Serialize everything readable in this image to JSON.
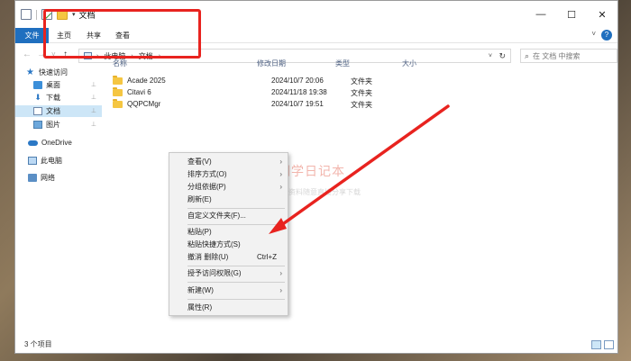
{
  "window": {
    "title": "文档",
    "quick_access_dropdown": "▾",
    "controls": {
      "minimize": "—",
      "maximize": "☐",
      "close": "✕"
    }
  },
  "ribbon": {
    "tabs": [
      {
        "label": "文件"
      },
      {
        "label": "主页"
      },
      {
        "label": "共享"
      },
      {
        "label": "查看"
      }
    ],
    "collapse": "˅",
    "help": "?"
  },
  "navigation": {
    "back": "←",
    "forward": "→",
    "recent": "˅",
    "up": "↑"
  },
  "address_bar": {
    "segments": [
      "此电脑",
      "文档"
    ],
    "separator": "›",
    "dropdown": "˅",
    "refresh": "↻"
  },
  "search": {
    "placeholder": "在 文档 中搜索",
    "icon": "search-icon"
  },
  "sidebar": {
    "items": [
      {
        "label": "快速访问",
        "icon": "star-icon"
      },
      {
        "label": "桌面",
        "icon": "desktop-icon",
        "pinned": true
      },
      {
        "label": "下载",
        "icon": "download-icon",
        "pinned": true
      },
      {
        "label": "文档",
        "icon": "documents-icon",
        "pinned": true,
        "selected": true
      },
      {
        "label": "图片",
        "icon": "pictures-icon",
        "pinned": true
      },
      {
        "label": "OneDrive",
        "icon": "onedrive-icon"
      },
      {
        "label": "此电脑",
        "icon": "this-pc-icon"
      },
      {
        "label": "网络",
        "icon": "network-icon"
      }
    ],
    "pin_glyph": "📌",
    "star_glyph": "★",
    "download_glyph": "⬇"
  },
  "file_list": {
    "columns": [
      "名称",
      "修改日期",
      "类型",
      "大小"
    ],
    "rows": [
      {
        "name": "Acade 2025",
        "modified": "2024/10/7 20:06",
        "type": "文件夹",
        "size": ""
      },
      {
        "name": "Citavi 6",
        "modified": "2024/11/18 19:38",
        "type": "文件夹",
        "size": ""
      },
      {
        "name": "QQPCMgr",
        "modified": "2024/10/7 19:51",
        "type": "文件夹",
        "size": ""
      }
    ]
  },
  "status_bar": {
    "item_count": "3 个项目"
  },
  "context_menu": {
    "items": [
      {
        "label": "查看(V)",
        "submenu": true
      },
      {
        "label": "排序方式(O)",
        "submenu": true
      },
      {
        "label": "分组依据(P)",
        "submenu": true
      },
      {
        "label": "刷新(E)"
      },
      {
        "label": "自定义文件夹(F)..."
      },
      {
        "label": "粘贴(P)"
      },
      {
        "label": "粘贴快捷方式(S)"
      },
      {
        "label": "撤消 删除(U)",
        "shortcut": "Ctrl+Z"
      },
      {
        "label": "授予访问权限(G)",
        "submenu": true
      },
      {
        "label": "新建(W)",
        "submenu": true
      },
      {
        "label": "属性(R)"
      }
    ],
    "submenu_glyph": "›"
  },
  "watermark": {
    "title": "同学日记本",
    "subtitle": "软件、资源、资料随意直接分享下载"
  },
  "annotation": {
    "highlight_color": "#e8231f"
  }
}
